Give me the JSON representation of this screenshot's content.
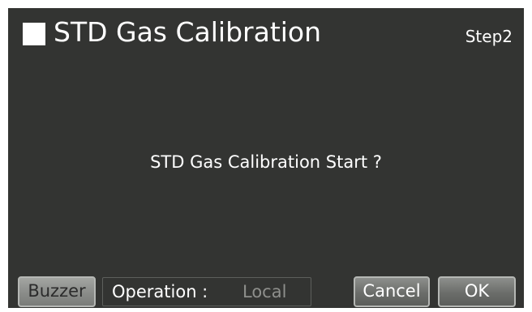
{
  "header": {
    "title": "STD Gas Calibration",
    "step": "Step2"
  },
  "dialog": {
    "message": "STD Gas Calibration Start ?"
  },
  "footer": {
    "buzzer_label": "Buzzer",
    "operation_label": "Operation :",
    "operation_value": "Local",
    "cancel_label": "Cancel",
    "ok_label": "OK"
  },
  "colors": {
    "background": "#333432",
    "text": "#ffffff",
    "muted_text": "#8e8f8c",
    "button": "#6b6d6a"
  }
}
